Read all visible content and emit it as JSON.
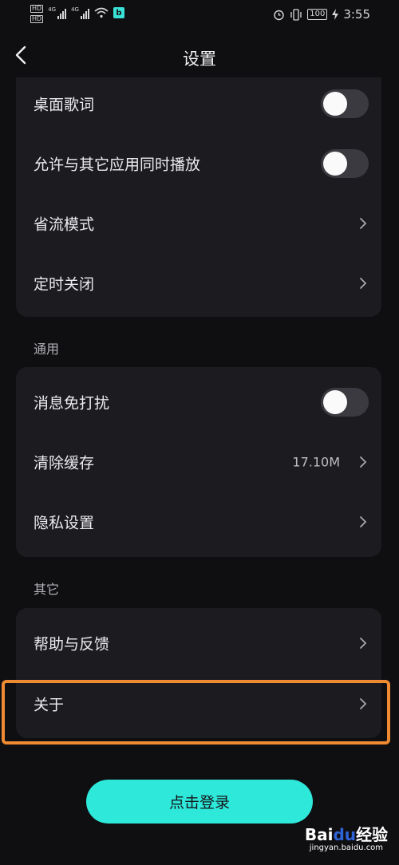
{
  "status_bar": {
    "hd1": "HD",
    "hd2": "HD",
    "net1": "4G",
    "net2": "4G",
    "battery": "100",
    "time": "3:55"
  },
  "header": {
    "title": "设置"
  },
  "sections": {
    "playback": {
      "rows": [
        {
          "label": "桌面歌词",
          "type": "toggle",
          "on": false
        },
        {
          "label": "允许与其它应用同时播放",
          "type": "toggle",
          "on": false
        },
        {
          "label": "省流模式",
          "type": "link"
        },
        {
          "label": "定时关闭",
          "type": "link"
        }
      ]
    },
    "general": {
      "title": "通用",
      "rows": [
        {
          "label": "消息免打扰",
          "type": "toggle",
          "on": false
        },
        {
          "label": "清除缓存",
          "type": "link",
          "value": "17.10M"
        },
        {
          "label": "隐私设置",
          "type": "link"
        }
      ]
    },
    "other": {
      "title": "其它",
      "rows": [
        {
          "label": "帮助与反馈",
          "type": "link"
        },
        {
          "label": "关于",
          "type": "link"
        }
      ]
    }
  },
  "login_button": {
    "label": "点击登录"
  },
  "watermark": {
    "brand_a": "Bai",
    "brand_b": "du",
    "brand_c": "经验",
    "sub": "jingyan.baidu.com"
  },
  "colors": {
    "accent": "#2ee8da",
    "highlight": "#ee8a32",
    "card": "#1c1c20",
    "background": "#0f0f12"
  }
}
